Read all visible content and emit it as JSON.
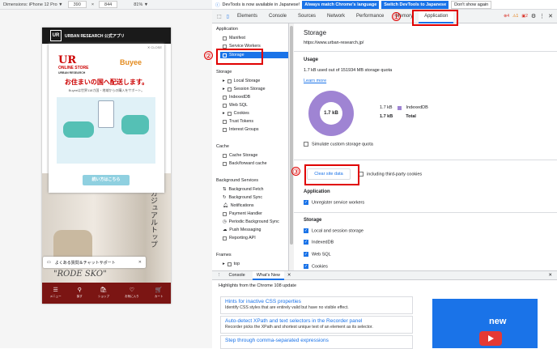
{
  "device_toolbar": {
    "dimensions_label": "Dimensions: iPhone 12 Pro ▼",
    "width": "390",
    "height": "844",
    "zoom": "81% ▼"
  },
  "phone": {
    "header_text": "URBAN RESEARCH 公式アプリ",
    "logo": "UR",
    "modal_close": "✕ CLOSE",
    "ur_online": "UR",
    "ur_online_text": "ONLINE STORE",
    "ur_online_sub": "URBAN RESEARCH",
    "buyee": "Buyee",
    "headline": "お住まいの国へ配送します。",
    "subtext": "Buyeeは世界118カ国・地域からの購入をサポート。",
    "how_to_button": "続い方はこちら",
    "vertical_text": "ガジュアルトップ",
    "chat_text": "よくある質問＆チャットサポート",
    "chat_close": "✕",
    "rode": "\"RODE SKO\"",
    "nav": [
      {
        "icon": "☰",
        "label": "メニュー"
      },
      {
        "icon": "⚲",
        "label": "探す"
      },
      {
        "icon": "🛍",
        "label": "ショップ"
      },
      {
        "icon": "♡",
        "label": "お気に入り"
      },
      {
        "icon": "🛒",
        "label": "カート"
      }
    ]
  },
  "infobar": {
    "message": "DevTools is now available in Japanese!",
    "btn1": "Always match Chrome's language",
    "btn2": "Switch DevTools to Japanese",
    "btn3": "Don't show again"
  },
  "tabs": [
    "Elements",
    "Console",
    "Sources",
    "Network",
    "Performance",
    "Memory",
    "Application"
  ],
  "toolbar_badges": {
    "errors": "4",
    "warnings": "1",
    "issues": "2"
  },
  "sidebar": {
    "application_header": "Application",
    "app_items": [
      "Manifest",
      "Service Workers",
      "Storage"
    ],
    "storage_header": "Storage",
    "storage_items": [
      "Local Storage",
      "Session Storage",
      "IndexedDB",
      "Web SQL",
      "Cookies",
      "Trust Tokens",
      "Interest Groups"
    ],
    "cache_header": "Cache",
    "cache_items": [
      "Cache Storage",
      "Back/forward cache"
    ],
    "bg_header": "Background Services",
    "bg_items": [
      "Background Fetch",
      "Background Sync",
      "Notifications",
      "Payment Handler",
      "Periodic Background Sync",
      "Push Messaging",
      "Reporting API"
    ],
    "frames_header": "Frames",
    "frames_items": [
      "top"
    ]
  },
  "main": {
    "title": "Storage",
    "origin": "https://www.urban-research.jp/",
    "usage_header": "Usage",
    "usage_text": "1.7 kB used out of 151934 MB storage quota",
    "learn_more": "Learn more",
    "donut_label": "1.7 kB",
    "legend_value": "1.7 kB",
    "legend_name": "IndexedDB",
    "total_value": "1.7 kB",
    "total_label": "Total",
    "simulate": "Simulate custom storage quota",
    "clear_button": "Clear site data",
    "third_party": "including third-party cookies",
    "application_header": "Application",
    "unregister": "Unregister service workers",
    "storage_header": "Storage",
    "local_session": "Local and session storage",
    "indexeddb": "IndexedDB",
    "websql": "Web SQL",
    "cookies": "Cookies"
  },
  "drawer": {
    "tabs": [
      "Console",
      "What's New"
    ],
    "highlights": "Highlights from the Chrome 108 update",
    "cards": [
      {
        "title": "Hints for inactive CSS properties",
        "desc": "Identify CSS styles that are entirely valid but have no visible effect."
      },
      {
        "title": "Auto-detect XPath and text selectors in the Recorder panel",
        "desc": "Recorder picks the XPath and shortest unique text of an element as its selector."
      },
      {
        "title": "Step through comma-separated expressions",
        "desc": ""
      }
    ],
    "video_word": "new"
  },
  "annotations": {
    "n1": "①",
    "n2": "②",
    "n3": "③"
  }
}
